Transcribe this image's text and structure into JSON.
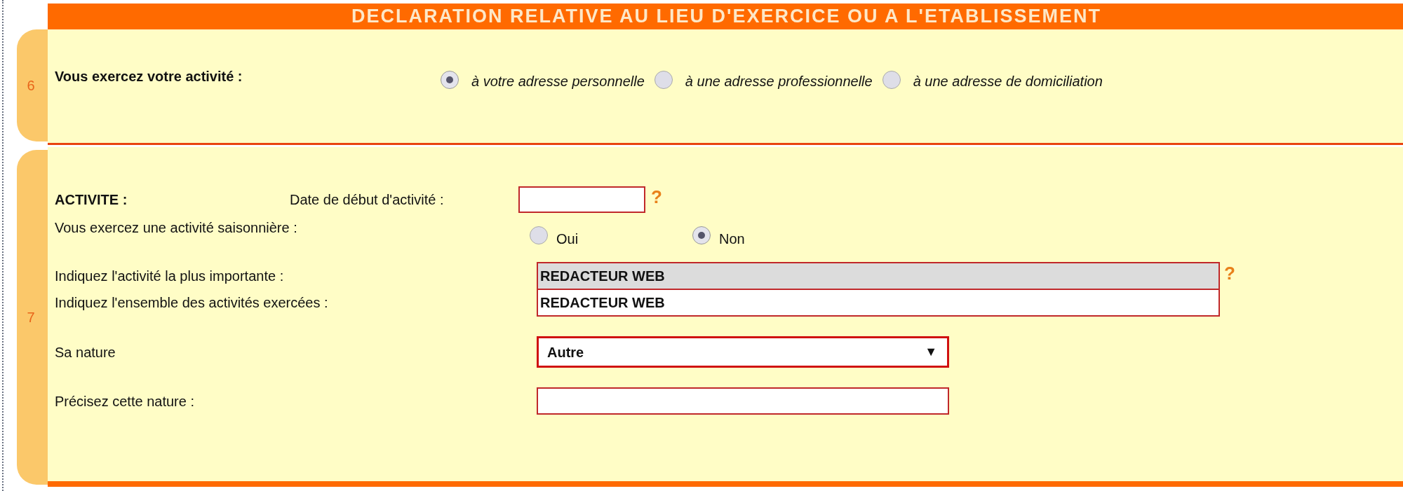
{
  "header": "DECLARATION RELATIVE AU LIEU D'EXERCICE OU A L'ETABLISSEMENT",
  "location_section": {
    "number": "6",
    "label": "Vous exercez votre activité :",
    "options": [
      {
        "label": "à votre adresse personnelle",
        "selected": true
      },
      {
        "label": "à une adresse professionnelle",
        "selected": false
      },
      {
        "label": "à une adresse de domiciliation",
        "selected": false
      }
    ]
  },
  "activity_section": {
    "number": "7",
    "heading": "ACTIVITE :",
    "start_date": {
      "label": "Date de début d'activité :",
      "help": "?"
    },
    "seasonal": {
      "label": "Vous exercez une activité saisonnière :",
      "options": [
        {
          "label": "Oui",
          "selected": false
        },
        {
          "label": "Non",
          "selected": true
        }
      ]
    },
    "main_activity": {
      "label": "Indiquez l'activité la plus importante :",
      "value": "REDACTEUR WEB",
      "highlighted": true,
      "help": "?"
    },
    "all_activities": {
      "label": "Indiquez l'ensemble des activités exercées :",
      "value": "REDACTEUR WEB",
      "highlighted": false
    },
    "nature": {
      "label": "Sa nature",
      "value": "Autre",
      "arrow": "▼"
    },
    "nature_detail": {
      "label": "Précisez cette nature :"
    }
  }
}
